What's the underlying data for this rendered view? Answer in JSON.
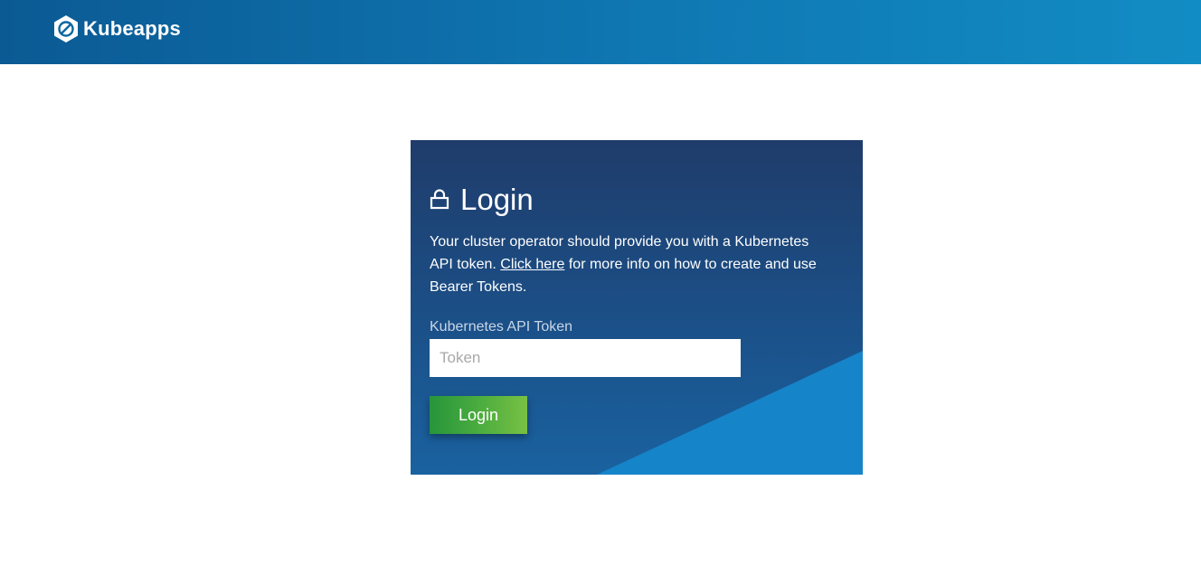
{
  "header": {
    "brand_name": "Kubeapps",
    "logo_icon": "kubeapps-logo-icon",
    "background_start": "#0b5a94",
    "background_end": "#128cc4"
  },
  "login_card": {
    "lock_icon": "lock-icon",
    "title": "Login",
    "description_before_link": "Your cluster operator should provide you with a Kubernetes API token. ",
    "link_text": "Click here",
    "description_after_link": " for more info on how to create and use Bearer Tokens.",
    "token_label": "Kubernetes API Token",
    "token_value": "",
    "token_placeholder": "Token",
    "login_button_label": "Login",
    "accent_color": "#1684c8",
    "button_color_start": "#27953b",
    "button_color_end": "#79c044"
  }
}
